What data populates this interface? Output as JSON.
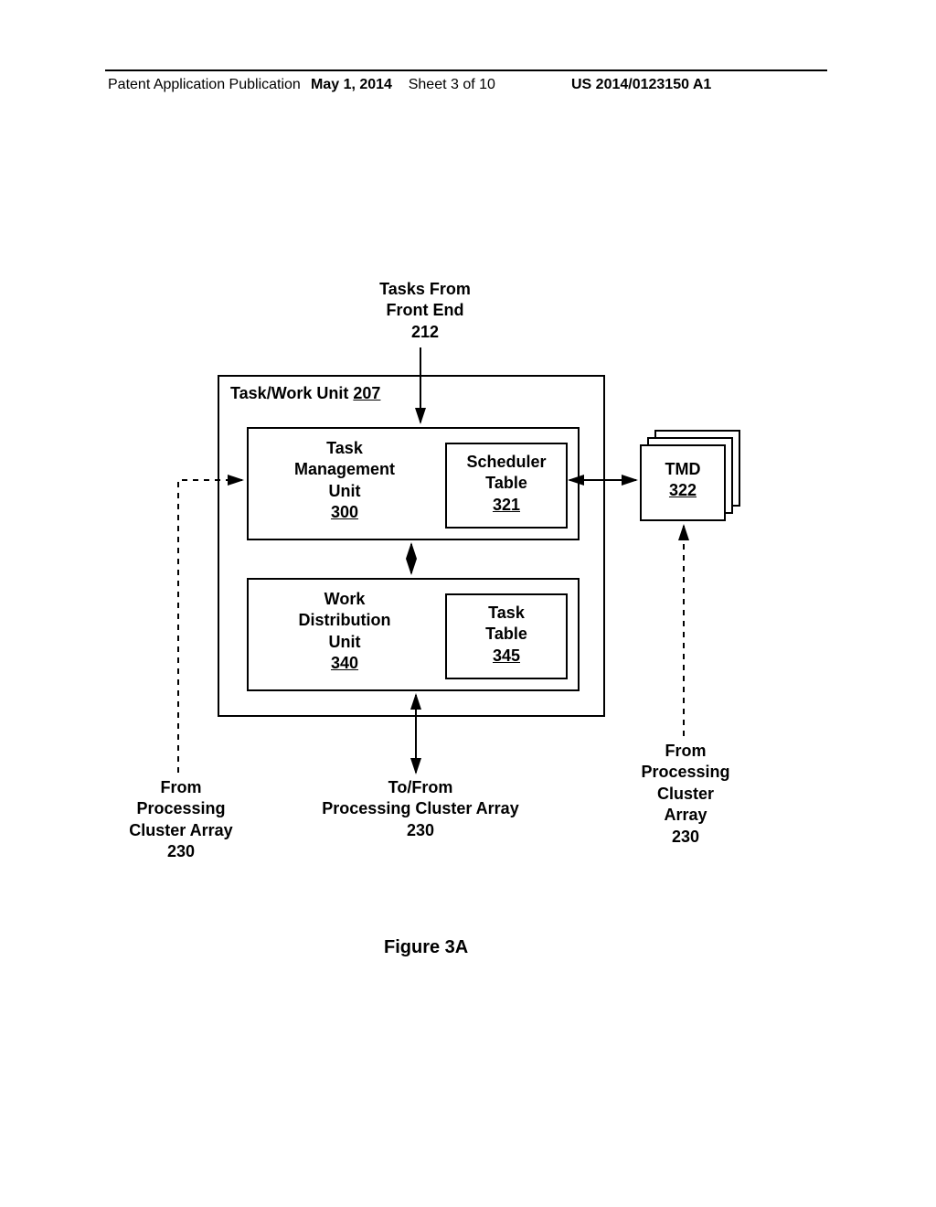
{
  "header": {
    "left": "Patent Application Publication",
    "date": "May 1, 2014",
    "sheet": "Sheet 3 of 10",
    "pubnum": "US 2014/0123150 A1"
  },
  "labels": {
    "tasks_from": "Tasks From",
    "front_end": "Front End",
    "front_end_num": "212",
    "task_work_unit": "Task/Work Unit",
    "task_work_unit_num": "207",
    "tmu_line1": "Task",
    "tmu_line2": "Management",
    "tmu_line3": "Unit",
    "tmu_num": "300",
    "sched_line1": "Scheduler",
    "sched_line2": "Table",
    "sched_num": "321",
    "tmd": "TMD",
    "tmd_num": "322",
    "wdu_line1": "Work",
    "wdu_line2": "Distribution",
    "wdu_line3": "Unit",
    "wdu_num": "340",
    "task_table_line1": "Task",
    "task_table_line2": "Table",
    "task_table_num": "345",
    "from": "From",
    "processing": "Processing",
    "cluster": "Cluster",
    "array": "Array",
    "cluster_array": "Cluster Array",
    "tofrom": "To/From",
    "pca": "Processing Cluster Array",
    "pca_num": "230"
  },
  "figure_caption": "Figure 3A",
  "chart_data": {
    "type": "diagram",
    "title": "Figure 3A — Task/Work Unit block diagram",
    "nodes": [
      {
        "id": "front_end_212",
        "label": "Tasks From Front End 212",
        "kind": "external"
      },
      {
        "id": "task_work_unit_207",
        "label": "Task/Work Unit 207",
        "kind": "container",
        "children": [
          "tmu_300",
          "wdu_340"
        ]
      },
      {
        "id": "tmu_300",
        "label": "Task Management Unit 300",
        "kind": "block",
        "children": [
          "scheduler_table_321"
        ]
      },
      {
        "id": "scheduler_table_321",
        "label": "Scheduler Table 321",
        "kind": "block"
      },
      {
        "id": "wdu_340",
        "label": "Work Distribution Unit 340",
        "kind": "block",
        "children": [
          "task_table_345"
        ]
      },
      {
        "id": "task_table_345",
        "label": "Task Table 345",
        "kind": "block"
      },
      {
        "id": "tmd_322",
        "label": "TMD 322",
        "kind": "block_stack"
      },
      {
        "id": "pca_230_left",
        "label": "From Processing Cluster Array 230",
        "kind": "external"
      },
      {
        "id": "pca_230_bottom",
        "label": "To/From Processing Cluster Array 230",
        "kind": "external"
      },
      {
        "id": "pca_230_right",
        "label": "From Processing Cluster Array 230",
        "kind": "external"
      }
    ],
    "edges": [
      {
        "from": "front_end_212",
        "to": "tmu_300",
        "style": "solid",
        "dir": "uni"
      },
      {
        "from": "tmu_300",
        "to": "wdu_340",
        "style": "solid",
        "dir": "bi"
      },
      {
        "from": "wdu_340",
        "to": "pca_230_bottom",
        "style": "solid",
        "dir": "bi"
      },
      {
        "from": "scheduler_table_321",
        "to": "tmd_322",
        "style": "solid",
        "dir": "bi"
      },
      {
        "from": "pca_230_left",
        "to": "tmu_300",
        "style": "dashed",
        "dir": "uni"
      },
      {
        "from": "pca_230_right",
        "to": "tmd_322",
        "style": "dashed",
        "dir": "uni"
      }
    ]
  }
}
